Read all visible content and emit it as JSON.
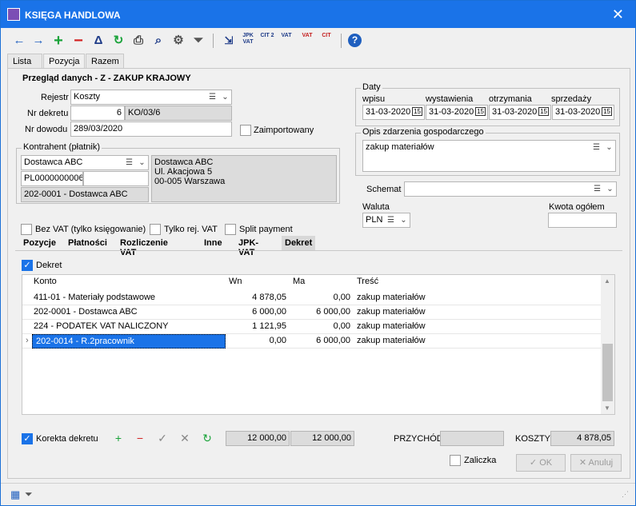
{
  "window": {
    "title": "KSIĘGA HANDLOWA",
    "close_label": "✕"
  },
  "toolbar": {
    "back": "←",
    "forward": "→",
    "add": "+",
    "remove": "−",
    "filter_tri": "Δ",
    "refresh": "↻",
    "print": "⎙",
    "search": "⌕",
    "settings": "⚙",
    "funnel": "⏷",
    "jpk_vat": "JPK VAT",
    "cit2": "CIT 2",
    "vat_stack": "VAT",
    "vat": "VAT",
    "cit": "CIT",
    "help": "?"
  },
  "tabs_main": [
    "Lista",
    "Pozycja",
    "Razem"
  ],
  "section_title": "Przegląd danych - Z - ZAKUP KRAJOWY",
  "form": {
    "rejestr_label": "Rejestr",
    "rejestr_value": "Koszty",
    "nr_dekretu_label": "Nr dekretu",
    "nr_dekretu_num": "6",
    "nr_dekretu_code": "KO/03/6",
    "nr_dowodu_label": "Nr dowodu",
    "nr_dowodu_value": "289/03/2020",
    "zaimportowany_label": "Zaimportowany"
  },
  "kontrahent": {
    "caption": "Kontrahent (płatnik)",
    "name": "Dostawca ABC",
    "nip": "PL0000000006",
    "konto": "202-0001 - Dostawca ABC",
    "address_line1": "Dostawca ABC",
    "address_line2": "Ul. Akacjowa 5",
    "address_line3": "00-005 Warszawa"
  },
  "daty": {
    "caption": "Daty",
    "wpisu_label": "wpisu",
    "wystawienia_label": "wystawienia",
    "otrzymania_label": "otrzymania",
    "sprzedazy_label": "sprzedaży",
    "wpisu": "31-03-2020",
    "wystawienia": "31-03-2020",
    "otrzymania": "31-03-2020",
    "sprzedazy": "31-03-2020",
    "cal_icon": "15"
  },
  "opis": {
    "caption": "Opis zdarzenia gospodarczego",
    "value": "zakup materiałów"
  },
  "schemat_label": "Schemat",
  "waluta": {
    "label": "Waluta",
    "value": "PLN"
  },
  "kwota_ogolem_label": "Kwota ogółem",
  "options": {
    "bez_vat": "Bez VAT (tylko księgowanie)",
    "tylko_rej_vat": "Tylko rej. VAT",
    "split_payment": "Split payment"
  },
  "tabs_sub": [
    "Pozycje",
    "Płatności",
    "Rozliczenie VAT",
    "Inne",
    "JPK-VAT",
    "Dekret"
  ],
  "dekret_checkbox": "Dekret",
  "grid": {
    "headers": {
      "konto": "Konto",
      "wn": "Wn",
      "ma": "Ma",
      "tresc": "Treść"
    },
    "rows": [
      {
        "konto": "411-01 - Materiały podstawowe",
        "wn": "4 878,05",
        "ma": "0,00",
        "tresc": "zakup materiałów"
      },
      {
        "konto": "202-0001 - Dostawca ABC",
        "wn": "6 000,00",
        "ma": "6 000,00",
        "tresc": "zakup materiałów"
      },
      {
        "konto": "224 - PODATEK VAT NALICZONY",
        "wn": "1 121,95",
        "ma": "0,00",
        "tresc": "zakup materiałów"
      },
      {
        "konto": "202-0014 - R.2pracownik",
        "wn": "0,00",
        "ma": "6 000,00",
        "tresc": "zakup materiałów"
      }
    ]
  },
  "footer": {
    "korekta_label": "Korekta dekretu",
    "sum_wn": "12 000,00",
    "sum_ma": "12 000,00",
    "przychod_label": "PRZYCHÓD",
    "koszty_label": "KOSZTY",
    "koszty_value": "4 878,05",
    "zaliczka_label": "Zaliczka",
    "ok_label": "OK",
    "anuluj_label": "Anuluj"
  }
}
